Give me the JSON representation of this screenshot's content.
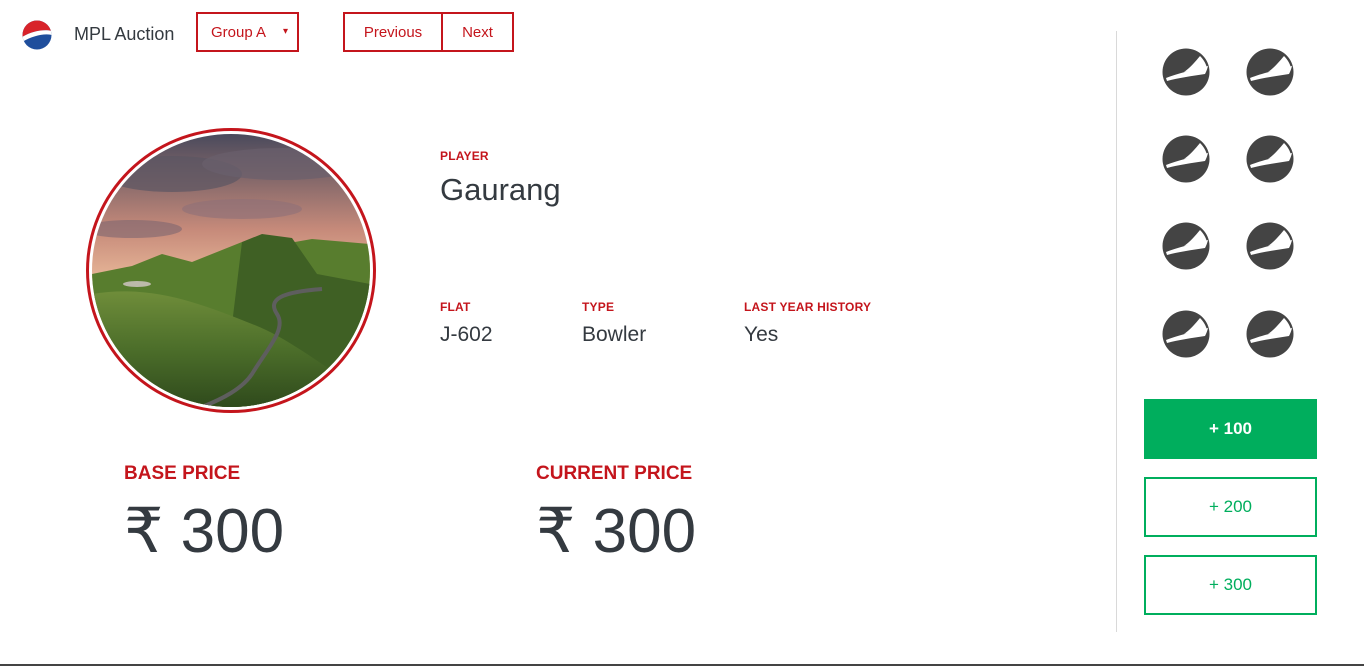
{
  "header": {
    "app_title": "MPL Auction",
    "group_select": {
      "selected": "Group A",
      "caret": "▾"
    },
    "pager": {
      "previous_label": "Previous",
      "next_label": "Next"
    }
  },
  "player": {
    "label": "Player",
    "name": "Gaurang",
    "details": [
      {
        "label": "Flat",
        "value": "J-602"
      },
      {
        "label": "Type",
        "value": "Bowler"
      },
      {
        "label": "Last Year History",
        "value": "Yes"
      }
    ]
  },
  "prices": {
    "base": {
      "label": "Base Price",
      "value": "₹ 300"
    },
    "current": {
      "label": "Current Price",
      "value": "₹ 300"
    }
  },
  "teams": {
    "icon": "team-logo-icon",
    "count": 8,
    "color": "#444444"
  },
  "bids": [
    {
      "label": "+ 100",
      "selected": true
    },
    {
      "label": "+ 200",
      "selected": false
    },
    {
      "label": "+ 300",
      "selected": false
    }
  ],
  "colors": {
    "accent": "#c4151c",
    "bid_green": "#00ae5d",
    "text": "#343a40"
  }
}
